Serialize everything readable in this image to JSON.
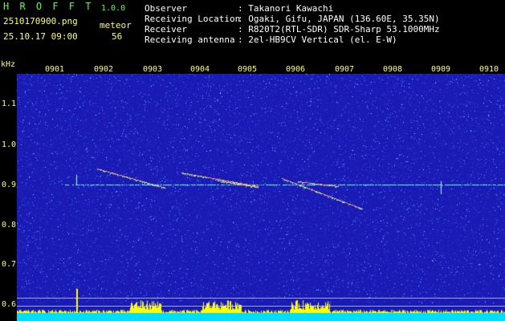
{
  "header": {
    "app_name": "H R O F F T",
    "version": "1.0.0",
    "filename": "2510170900.png",
    "datetime": "25.10.17 09:00",
    "meteor_label": "meteor",
    "meteor_count": "56",
    "observer_key": "Observer",
    "observer_val": ": Takanori Kawachi",
    "location_key": "Receiving Location",
    "location_val": ": Ogaki, Gifu, JAPAN (136.60E, 35.35N)",
    "receiver_key": "Receiver",
    "receiver_val": ": R820T2(RTL-SDR) SDR-Sharp 53.1000MHz",
    "antenna_key": "Receiving antenna",
    "antenna_val": ": 2el-HB9CV Vertical (el. E-W)"
  },
  "axes": {
    "y_unit": "kHz",
    "x_ticks": [
      "0901",
      "0902",
      "0903",
      "0904",
      "0905",
      "0906",
      "0907",
      "0908",
      "0909",
      "0910"
    ],
    "y_ticks": [
      "1.1",
      "1.0",
      "0.9",
      "0.8",
      "0.7",
      "0.6"
    ]
  },
  "colors": {
    "background": "#1a1ab4",
    "carrier": "#66ffff",
    "meteor": "#ffe066",
    "bars": "#ffff00",
    "floor": "#00ddff",
    "text": "#ffff66"
  }
}
